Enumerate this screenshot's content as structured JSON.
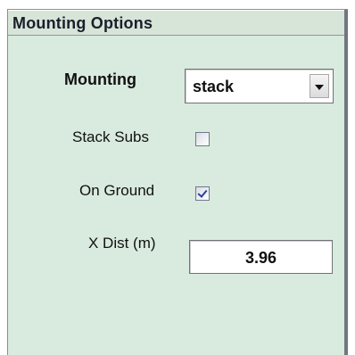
{
  "panel": {
    "title": "Mounting Options"
  },
  "mounting": {
    "label": "Mounting",
    "selected": "stack"
  },
  "stack_subs": {
    "label": "Stack Subs",
    "checked": false
  },
  "on_ground": {
    "label": "On Ground",
    "checked": true
  },
  "x_dist": {
    "label": "X Dist (m)",
    "value": "3.96"
  },
  "colors": {
    "panel_background": "#d9eade",
    "title_bar": "#d7e4d8",
    "check_mark": "#2b3f9a"
  },
  "icons": {
    "dropdown": "chevron-down-icon",
    "check": "checkmark-icon"
  }
}
